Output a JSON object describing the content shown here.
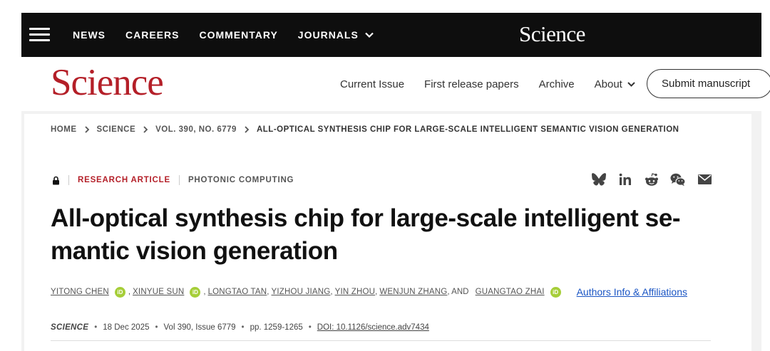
{
  "topbar": {
    "nav": [
      "NEWS",
      "CAREERS",
      "COMMENTARY",
      "JOURNALS"
    ],
    "logo": "Science"
  },
  "header": {
    "logo": "Science",
    "nav": [
      "Current Issue",
      "First release papers",
      "Archive",
      "About"
    ],
    "submit": "Submit manuscript"
  },
  "breadcrumb": [
    "HOME",
    "SCIENCE",
    "VOL. 390, NO. 6779",
    "ALL-OPTICAL SYNTHESIS CHIP FOR LARGE-SCALE INTELLIGENT SEMANTIC VISION GENERATION"
  ],
  "article": {
    "type": "RESEARCH ARTICLE",
    "subject": "PHOTONIC COMPUTING",
    "title": "All-optical synthesis chip for large-scale intelligent se-mantic vision generation",
    "authors": [
      "Yitong Chen",
      "Xinyue Sun",
      "Longtao Tan",
      "Yizhou Jiang",
      "Yin Zhou",
      "Wenjun Zhang",
      "Guangtao Zhai"
    ],
    "and": ", AND",
    "orcid": "iD",
    "affiliations_link": "Authors Info & Affiliations"
  },
  "citation": {
    "journal": "SCIENCE",
    "date": "18 Dec 2025",
    "volume": "Vol 390, Issue 6779",
    "pages": "pp. 1259-1265",
    "doi": "DOI: 10.1126/science.adv7434",
    "sep": "•"
  },
  "icons": {
    "menu": "hamburger-icon",
    "lock": "lock-icon",
    "share": [
      "bluesky-icon",
      "linkedin-icon",
      "reddit-icon",
      "wechat-icon",
      "email-icon"
    ]
  }
}
